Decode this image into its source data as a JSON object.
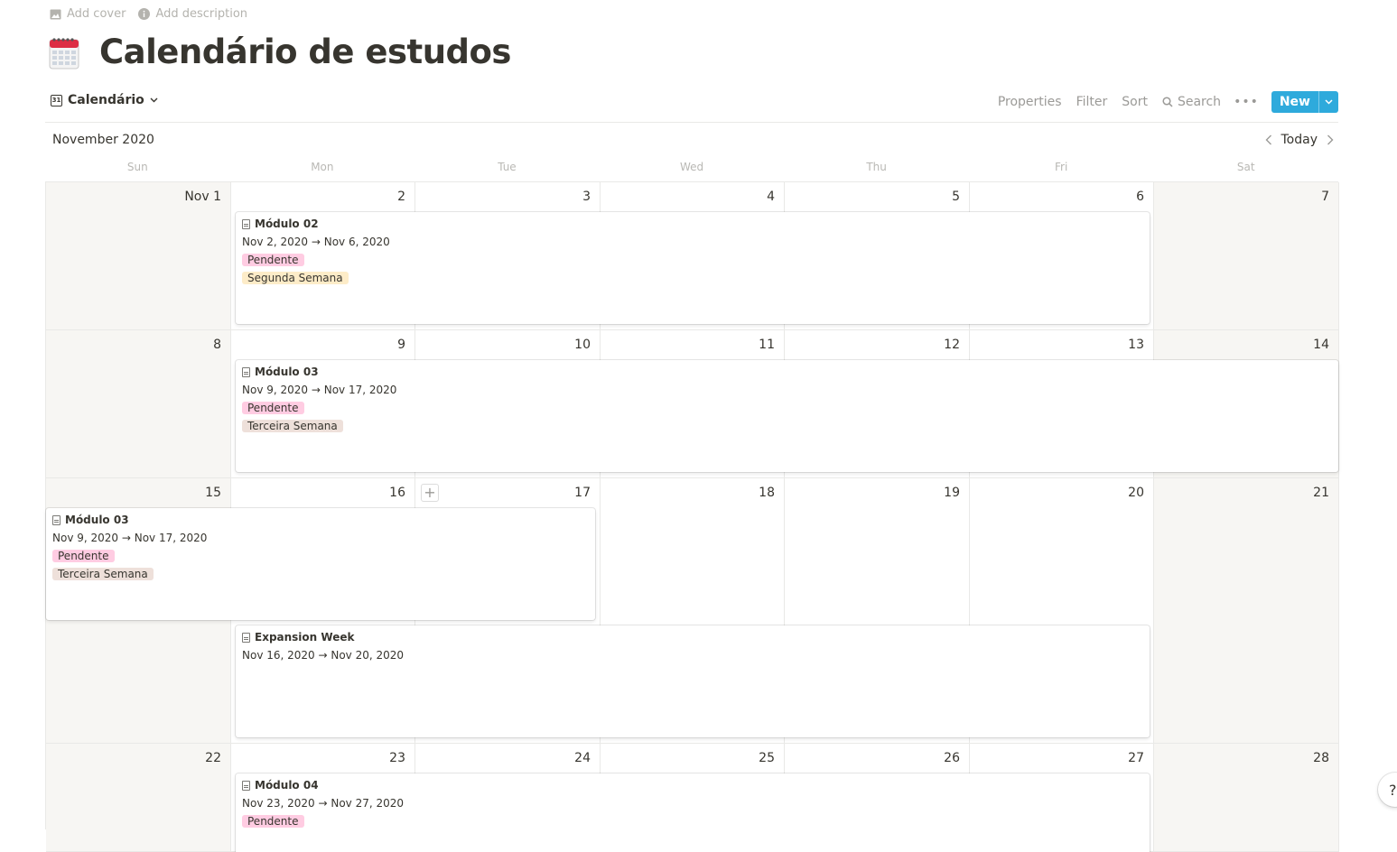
{
  "top_links": {
    "add_cover": "Add cover",
    "add_description": "Add description"
  },
  "page": {
    "icon": "calendar-emoji-icon",
    "title": "Calendário de estudos"
  },
  "toolbar": {
    "view_name": "Calendário",
    "properties": "Properties",
    "filter": "Filter",
    "sort": "Sort",
    "search": "Search",
    "more": "•••",
    "new": "New"
  },
  "calendar": {
    "month": "November 2020",
    "today": "Today",
    "weekdays": [
      "Sun",
      "Mon",
      "Tue",
      "Wed",
      "Thu",
      "Fri",
      "Sat"
    ],
    "weeks": [
      {
        "days": [
          "Nov 1",
          "2",
          "3",
          "4",
          "5",
          "6",
          "7"
        ]
      },
      {
        "days": [
          "8",
          "9",
          "10",
          "11",
          "12",
          "13",
          "14"
        ]
      },
      {
        "days": [
          "15",
          "16",
          "17",
          "18",
          "19",
          "20",
          "21"
        ]
      },
      {
        "days": [
          "22",
          "23",
          "24",
          "25",
          "26",
          "27",
          "28"
        ]
      }
    ]
  },
  "events": [
    {
      "title": "Módulo 02",
      "date": "Nov 2, 2020 → Nov 6, 2020",
      "status": "Pendente",
      "week_tag": "Segunda Semana"
    },
    {
      "title": "Módulo 03",
      "date": "Nov 9, 2020 → Nov 17, 2020",
      "status": "Pendente",
      "week_tag": "Terceira Semana"
    },
    {
      "title": "Módulo 03",
      "date": "Nov 9, 2020 → Nov 17, 2020",
      "status": "Pendente",
      "week_tag": "Terceira Semana"
    },
    {
      "title": "Expansion Week",
      "date": "Nov 16, 2020 → Nov 20, 2020"
    },
    {
      "title": "Módulo 04",
      "date": "Nov 23, 2020 → Nov 27, 2020",
      "status": "Pendente"
    }
  ],
  "colors": {
    "accent": "#2eaadc",
    "weekend_bg": "#f7f6f3",
    "tag_pink": "#ffcce2",
    "tag_yellow": "#fdecc8",
    "tag_brown": "#eee0da"
  },
  "help": "?"
}
